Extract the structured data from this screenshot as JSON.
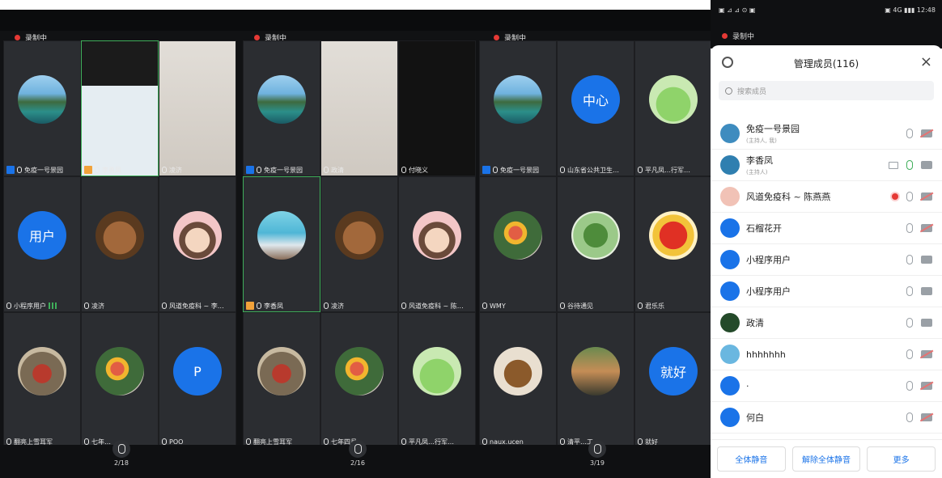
{
  "screens": [
    {
      "rec_label": "录制中",
      "bottom_count": "2/18",
      "tiles": [
        {
          "name": "免疫一号景园",
          "avatar": "landscape",
          "host": true
        },
        {
          "name": "李勇凤",
          "avatar": "video-person",
          "cohost": true,
          "active": true
        },
        {
          "name": "凌济",
          "avatar": "video-wall"
        },
        {
          "name": "小程序用户",
          "avatar": "blue",
          "avatar_text": "用户",
          "bars": true
        },
        {
          "name": "凌济",
          "avatar": "bear"
        },
        {
          "name": "风道免疫科 ~ 李…",
          "avatar": "girl"
        },
        {
          "name": "翻亮上雪耳军",
          "avatar": "pot"
        },
        {
          "name": "七年…",
          "avatar": "flowers"
        },
        {
          "name": "POO",
          "avatar": "blue",
          "avatar_text": "P"
        }
      ]
    },
    {
      "rec_label": "录制中",
      "bottom_count": "2/16",
      "tiles": [
        {
          "name": "免疫一号景园",
          "avatar": "landscape",
          "host": true
        },
        {
          "name": "政清",
          "avatar": "video-wall"
        },
        {
          "name": "付晓义",
          "avatar": "video-black"
        },
        {
          "name": "李香凤",
          "avatar": "ocean",
          "cohost": true,
          "active": true
        },
        {
          "name": "凌济",
          "avatar": "bear"
        },
        {
          "name": "风道免疫科 ~ 陈…",
          "avatar": "girl"
        },
        {
          "name": "翻亮上雪耳军",
          "avatar": "pot"
        },
        {
          "name": "七年四月",
          "avatar": "flowers"
        },
        {
          "name": "平凡凤…行军…",
          "avatar": "frog"
        }
      ]
    },
    {
      "rec_label": "录制中",
      "bottom_count": "3/19",
      "tiles": [
        {
          "name": "免疫一号景园",
          "avatar": "landscape",
          "host": true
        },
        {
          "name": "山东省公共卫生…",
          "avatar": "blue",
          "avatar_text": "中心"
        },
        {
          "name": "平凡凤…行军…",
          "avatar": "frog"
        },
        {
          "name": "WMY",
          "avatar": "flowers"
        },
        {
          "name": "谷待通见",
          "avatar": "plant"
        },
        {
          "name": "君乐乐",
          "avatar": "duck"
        },
        {
          "name": "naux.ucen",
          "avatar": "dog"
        },
        {
          "name": "清平…工",
          "avatar": "house"
        },
        {
          "name": "就好",
          "avatar": "blue",
          "avatar_text": "就好"
        }
      ]
    }
  ],
  "panel": {
    "phone_status_left": "▣ ⊿ ⊿ ⊙ ▣",
    "phone_status_right": "▣ 4G ▮▮▮ 12:48",
    "phone_sub_label": "录制中",
    "title": "管理成员(116)",
    "close_label": "×",
    "search_placeholder": "搜索成员",
    "members": [
      {
        "name": "免疫一号景园",
        "sub": "(主持人, 我)",
        "avatar_color": "#3e8cbf",
        "icons": [
          "mic",
          "cam-off"
        ]
      },
      {
        "name": "李香凤",
        "sub": "(主持人)",
        "avatar_color": "#2f7fb0",
        "icons": [
          "screen",
          "mic-on",
          "cam"
        ]
      },
      {
        "name": "风道免疫科 ~ 陈燕燕",
        "sub": "",
        "avatar_color": "#f1c2b6",
        "icons": [
          "rec",
          "mic",
          "cam-off"
        ]
      },
      {
        "name": "石榴花开",
        "sub": "",
        "avatar_color": "#1a73e8",
        "icons": [
          "mic",
          "cam-off"
        ]
      },
      {
        "name": "小程序用户",
        "sub": "",
        "avatar_color": "#1a73e8",
        "icons": [
          "mic",
          "cam"
        ]
      },
      {
        "name": "小程序用户",
        "sub": "",
        "avatar_color": "#1a73e8",
        "icons": [
          "mic",
          "cam"
        ]
      },
      {
        "name": "政清",
        "sub": "",
        "avatar_color": "#244a2a",
        "icons": [
          "mic",
          "cam"
        ]
      },
      {
        "name": "hhhhhhh",
        "sub": "",
        "avatar_color": "#6ab7e0",
        "icons": [
          "mic",
          "cam-off"
        ]
      },
      {
        "name": "·",
        "sub": "",
        "avatar_color": "#1a73e8",
        "icons": [
          "mic",
          "cam-off"
        ]
      },
      {
        "name": "何白",
        "sub": "",
        "avatar_color": "#1a73e8",
        "icons": [
          "mic",
          "cam-off"
        ]
      }
    ],
    "actions": [
      "全体静音",
      "解除全体静音",
      "更多"
    ]
  }
}
